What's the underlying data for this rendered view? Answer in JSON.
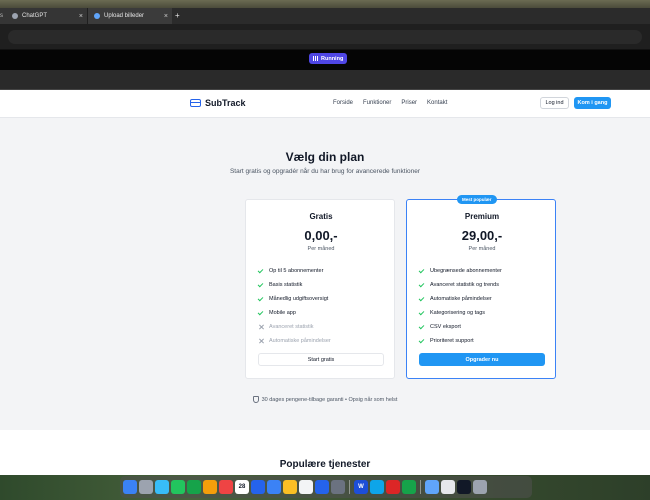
{
  "browser": {
    "tabs": [
      {
        "label": "ChatGPT",
        "fav_color": "#9ca3af"
      },
      {
        "label": "Upload billeder",
        "fav_color": "#60a5fa"
      }
    ],
    "close_glyph": "×",
    "new_tab_glyph": "+",
    "lead_glyph": "s"
  },
  "recorder": {
    "label": "Running"
  },
  "header": {
    "brand": "SubTrack",
    "nav": [
      "Forside",
      "Funktioner",
      "Priser",
      "Kontakt"
    ],
    "login_label": "Log ind",
    "start_label": "Kom i gang"
  },
  "pricing": {
    "title": "Vælg din plan",
    "subtitle": "Start gratis og opgradér når du har brug for avancerede funktioner",
    "badge": "Mest populær",
    "plans": [
      {
        "name": "Gratis",
        "price": "0,00,-",
        "period": "Per måned",
        "features": [
          {
            "text": "Op til 5 abonnementer",
            "included": true
          },
          {
            "text": "Basis statistik",
            "included": true
          },
          {
            "text": "Månedlig udgiftsoversigt",
            "included": true
          },
          {
            "text": "Mobile app",
            "included": true
          },
          {
            "text": "Avanceret statistik",
            "included": false
          },
          {
            "text": "Automatiske påmindelser",
            "included": false
          }
        ],
        "button": "Start gratis"
      },
      {
        "name": "Premium",
        "price": "29,00,-",
        "period": "Per måned",
        "features": [
          {
            "text": "Ubegrænsede abonnementer",
            "included": true
          },
          {
            "text": "Avanceret statistik og trends",
            "included": true
          },
          {
            "text": "Automatiske påmindelser",
            "included": true
          },
          {
            "text": "Kategorisering og tags",
            "included": true
          },
          {
            "text": "CSV eksport",
            "included": true
          },
          {
            "text": "Prioriteret support",
            "included": true
          }
        ],
        "button": "Opgrader nu"
      }
    ],
    "guarantee": "30 dages pengene-tilbage garanti • Opsig når som helst"
  },
  "services": {
    "title": "Populære tjenester"
  },
  "dock": {
    "icons": [
      {
        "name": "finder-icon",
        "color": "#3b82f6",
        "glyph": ""
      },
      {
        "name": "launchpad-icon",
        "color": "#9ca3af",
        "glyph": ""
      },
      {
        "name": "mail-icon",
        "color": "#38bdf8",
        "glyph": ""
      },
      {
        "name": "messages-icon",
        "color": "#22c55e",
        "glyph": ""
      },
      {
        "name": "facetime-icon",
        "color": "#16a34a",
        "glyph": ""
      },
      {
        "name": "photos-icon",
        "color": "#f59e0b",
        "glyph": ""
      },
      {
        "name": "chrome-icon",
        "color": "#ef4444",
        "glyph": ""
      },
      {
        "name": "calendar-icon",
        "color": "#ffffff",
        "glyph": "28"
      },
      {
        "name": "appstore-icon",
        "color": "#2563eb",
        "glyph": ""
      },
      {
        "name": "messenger-icon",
        "color": "#3b82f6",
        "glyph": ""
      },
      {
        "name": "notes-icon",
        "color": "#fbbf24",
        "glyph": ""
      },
      {
        "name": "reminders-icon",
        "color": "#f3f4f6",
        "glyph": ""
      },
      {
        "name": "tasks-icon",
        "color": "#2563eb",
        "glyph": ""
      },
      {
        "name": "settings-icon",
        "color": "#6b7280",
        "glyph": ""
      },
      {
        "name": "word-icon",
        "color": "#1d4ed8",
        "glyph": "W"
      },
      {
        "name": "outlook-icon",
        "color": "#0ea5e9",
        "glyph": ""
      },
      {
        "name": "powerpoint-icon",
        "color": "#dc2626",
        "glyph": ""
      },
      {
        "name": "numbers-icon",
        "color": "#16a34a",
        "glyph": ""
      },
      {
        "name": "folder-icon",
        "color": "#60a5fa",
        "glyph": ""
      },
      {
        "name": "screenshot-icon",
        "color": "#e5e7eb",
        "glyph": ""
      },
      {
        "name": "preview-icon",
        "color": "#111827",
        "glyph": ""
      },
      {
        "name": "trash-icon",
        "color": "#9ca3af",
        "glyph": ""
      }
    ]
  }
}
